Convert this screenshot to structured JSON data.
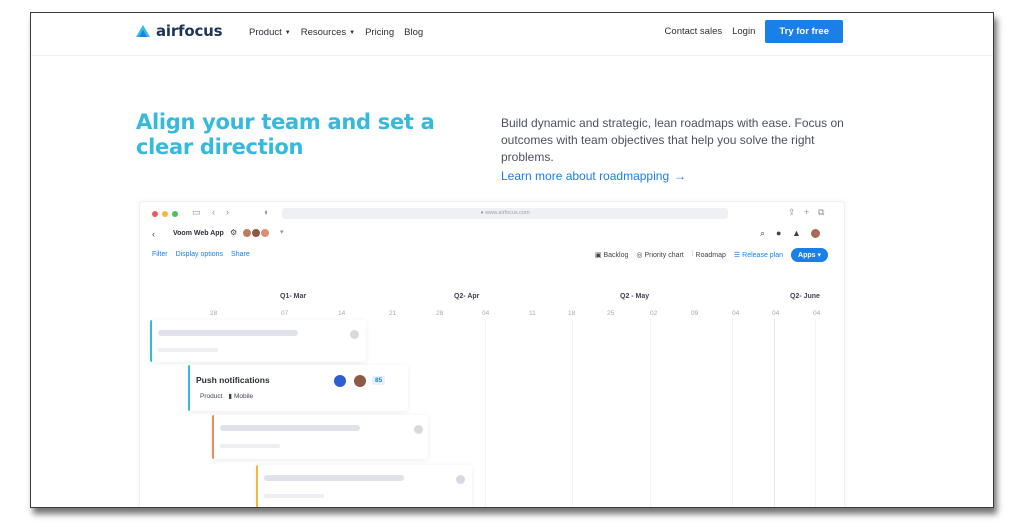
{
  "nav": {
    "logo_text": "airfocus",
    "links": [
      "Product",
      "Resources",
      "Pricing",
      "Blog"
    ],
    "contact_sales": "Contact sales",
    "login": "Login",
    "cta": "Try for free"
  },
  "hero": {
    "title": "Align your team and set a clear direction",
    "description": "Build dynamic and strategic, lean roadmaps with ease. Focus on outcomes with team objectives that help you solve the right problems.",
    "link": "Learn more about roadmapping",
    "link_arrow": "→"
  },
  "app": {
    "url": "● www.airfocus.com",
    "project_name": "Voom Web App",
    "left_tools": [
      "Filter",
      "Display options",
      "Share"
    ],
    "right_tools": [
      "Backlog",
      "Priority chart",
      "Roadmap",
      "Release plan"
    ],
    "apps_button": "Apps ▾",
    "quarters": [
      "Q1- Mar",
      "Q2- Apr",
      "Q2 - May",
      "Q2- June"
    ],
    "weeks": [
      "28",
      "07",
      "14",
      "21",
      "28",
      "04",
      "11",
      "18",
      "25",
      "02",
      "09",
      "04",
      "04"
    ],
    "push_card": {
      "title": "Push notifications",
      "tags": [
        "Product",
        "Mobile"
      ],
      "badge": "85"
    }
  },
  "colors": {
    "brand_blue": "#1a7fe6",
    "hero_title": "#35b9dd"
  }
}
